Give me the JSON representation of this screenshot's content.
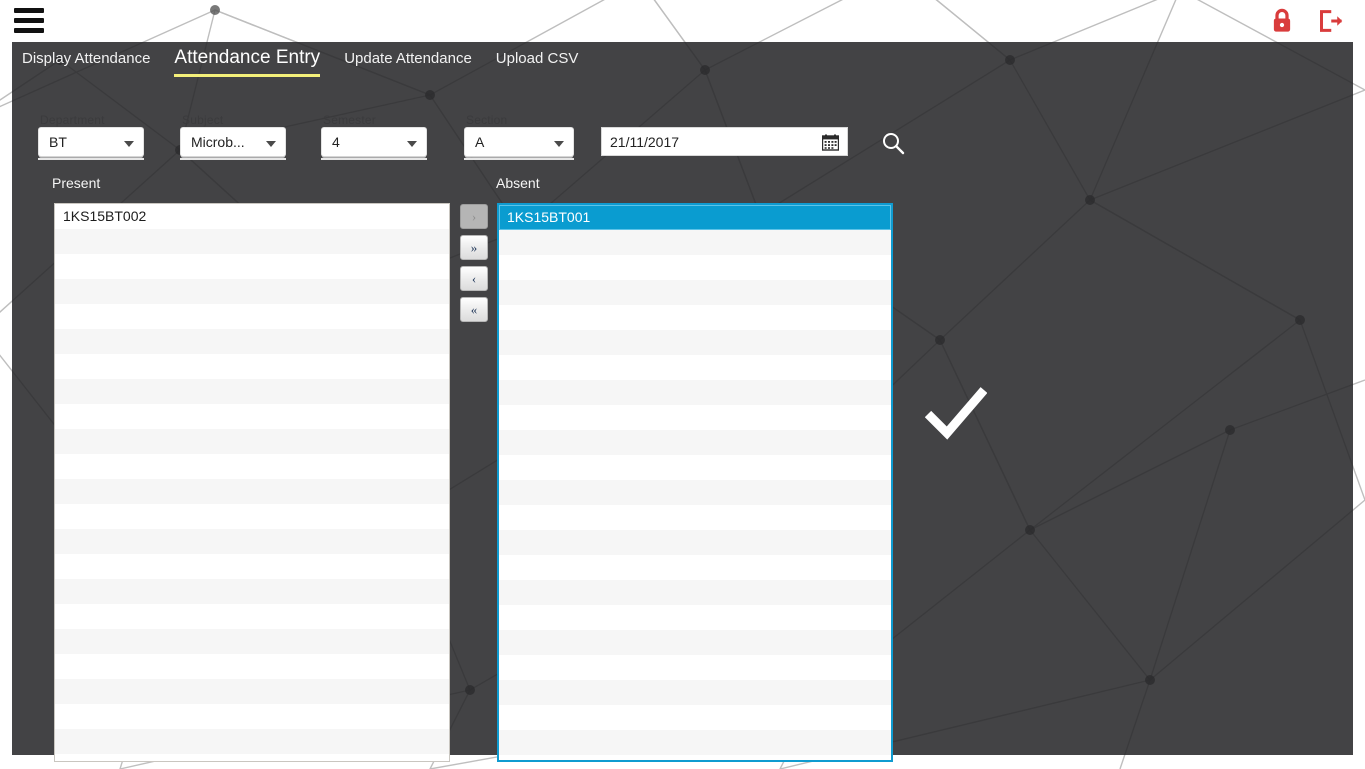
{
  "topbar": {
    "menu_icon": "hamburger-menu-icon",
    "lock_icon": "lock-icon",
    "logout_icon": "logout-icon",
    "icon_color": "#d93c3c"
  },
  "tabs": [
    {
      "label": "Display Attendance",
      "active": false
    },
    {
      "label": "Attendance Entry",
      "active": true
    },
    {
      "label": "Update Attendance",
      "active": false
    },
    {
      "label": "Upload CSV",
      "active": false
    }
  ],
  "active_tab_underline_color": "#f4f07a",
  "filters": {
    "department": {
      "label": "Department",
      "value": "BT"
    },
    "subject": {
      "label": "Subject",
      "value": "Microb..."
    },
    "semester": {
      "label": "Semester",
      "value": "4"
    },
    "section": {
      "label": "Section",
      "value": "A"
    },
    "date": {
      "value": "21/11/2017",
      "icon": "calendar-icon"
    },
    "search": {
      "icon": "search-icon"
    }
  },
  "lists": {
    "present": {
      "title": "Present",
      "items": [
        "1KS15BT002"
      ],
      "selected_index": -1,
      "empty_rows": 21
    },
    "absent": {
      "title": "Absent",
      "items": [
        "1KS15BT001"
      ],
      "selected_index": 0,
      "empty_rows": 21,
      "focus_border_color": "#0f9bd0",
      "selection_color": "#0a9cd0"
    }
  },
  "transfer_buttons": [
    {
      "label": "›",
      "name": "move-right-button",
      "disabled": true
    },
    {
      "label": "»",
      "name": "move-all-right-button",
      "disabled": false
    },
    {
      "label": "‹",
      "name": "move-left-button",
      "disabled": false
    },
    {
      "label": "«",
      "name": "move-all-left-button",
      "disabled": false
    }
  ],
  "watermark": {
    "icon": "check-mark-icon"
  }
}
